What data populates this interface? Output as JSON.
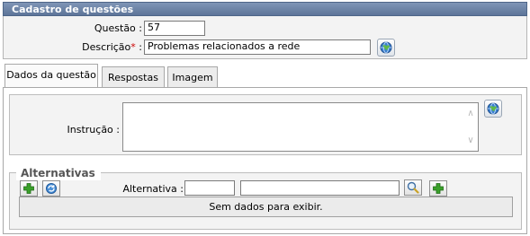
{
  "panel": {
    "title": "Cadastro de questões"
  },
  "form": {
    "questao_label": "Questão :",
    "questao_value": "57",
    "descricao_label": "Descrição",
    "required_mark": "*",
    "descricao_colon": ":",
    "descricao_value": "Problemas relacionados a rede"
  },
  "tabs": [
    {
      "label": "Dados da questão",
      "active": true
    },
    {
      "label": "Respostas",
      "active": false
    },
    {
      "label": "Imagem",
      "active": false
    }
  ],
  "dados": {
    "instrucao_label": "Instrução :",
    "instrucao_value": ""
  },
  "alternativas": {
    "legend": "Alternativas",
    "alternativa_label": "Alternativa :",
    "empty_text": "Sem dados para exibir."
  },
  "icons": {
    "globe": "globe-icon",
    "add": "plus-icon",
    "refresh": "refresh-icon",
    "search": "magnifier-icon"
  },
  "colors": {
    "header": "#6b82a6",
    "required": "#cc0000",
    "plus": "#2f9a1f"
  }
}
